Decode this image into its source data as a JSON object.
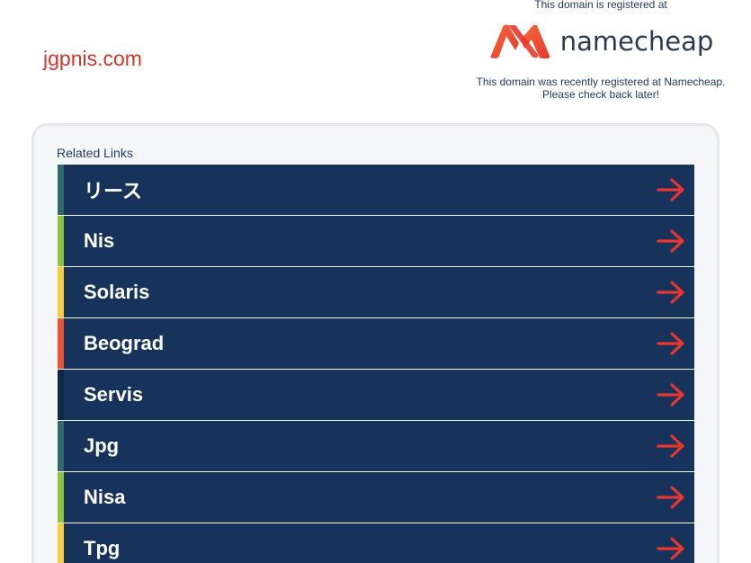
{
  "domain": "jgpnis.com",
  "registrar": {
    "registered_at": "This domain is registered at",
    "brand": "namecheap",
    "message_line1": "This domain was recently registered at Namecheap.",
    "message_line2": "Please check back later!"
  },
  "related": {
    "title": "Related Links",
    "links": [
      {
        "label": "リース",
        "accent": "#2f6b6b",
        "icon": "arrow-right-icon"
      },
      {
        "label": "Nis",
        "accent": "#8cc63f",
        "icon": "arrow-right-icon"
      },
      {
        "label": "Solaris",
        "accent": "#f4d03f",
        "icon": "arrow-right-icon"
      },
      {
        "label": "Beograd",
        "accent": "#e8543a",
        "icon": "arrow-right-icon"
      },
      {
        "label": "Servis",
        "accent": "#0f2748",
        "icon": "arrow-right-icon"
      },
      {
        "label": "Jpg",
        "accent": "#2f6b6b",
        "icon": "arrow-right-icon"
      },
      {
        "label": "Nisa",
        "accent": "#8cc63f",
        "icon": "arrow-right-icon"
      },
      {
        "label": "Tpg",
        "accent": "#f4d03f",
        "icon": "arrow-right-icon"
      }
    ]
  },
  "colors": {
    "domain_text": "#d7332b",
    "link_background": "#17325b",
    "arrow": "#e8372c",
    "logo_gradient_start": "#e8372c",
    "logo_gradient_end": "#f26b3a"
  }
}
